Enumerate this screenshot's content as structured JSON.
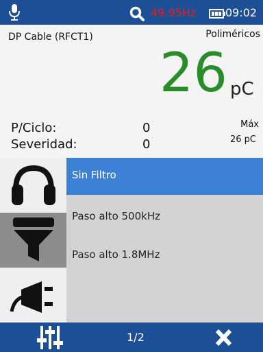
{
  "status": {
    "frequency": "49.95Hz",
    "time": "09:02"
  },
  "measurement": {
    "cable_name": "DP Cable (RFCT1)",
    "material": "Poliméricos",
    "value": "26",
    "unit": "pC",
    "per_cycle_label": "P/Ciclo:",
    "per_cycle_value": "0",
    "severity_label": "Severidad:",
    "severity_value": "0",
    "max_label": "Máx",
    "max_value": "26 pC"
  },
  "filter_menu": {
    "items": [
      {
        "label": "Sin Filtro",
        "selected": true
      },
      {
        "label": "Paso alto 500kHz",
        "selected": false
      },
      {
        "label": "Paso alto 1.8MHz",
        "selected": false
      }
    ]
  },
  "sidebar": {
    "icons": [
      "headphones-icon",
      "filter-icon",
      "plug-icon"
    ]
  },
  "bottombar": {
    "page": "1/2"
  },
  "colors": {
    "bar": "#1d4f96",
    "selected": "#3b82d7",
    "value": "#2a8d2a",
    "frequency": "#ee1b1b"
  }
}
